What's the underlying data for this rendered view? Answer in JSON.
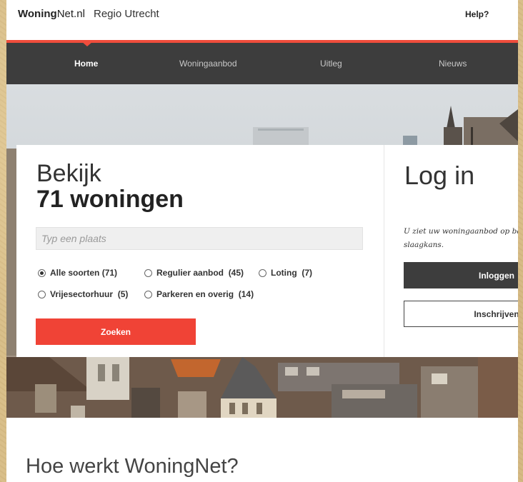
{
  "header": {
    "logo_bold": "Woning",
    "logo_rest": "Net.nl",
    "region": "Regio Utrecht",
    "help": "Help?"
  },
  "nav": {
    "items": [
      {
        "label": "Home",
        "active": true
      },
      {
        "label": "Woningaanbod",
        "active": false
      },
      {
        "label": "Uitleg",
        "active": false
      },
      {
        "label": "Nieuws",
        "active": false
      }
    ]
  },
  "search_card": {
    "title": "Bekijk",
    "count_label": "71 woningen",
    "placeholder": "Typ een plaats",
    "options": [
      {
        "label": "Alle soorten",
        "count": "(71)",
        "selected": true
      },
      {
        "label": "Regulier aanbod",
        "count": "(45)",
        "selected": false
      },
      {
        "label": "Loting",
        "count": "(7)",
        "selected": false
      },
      {
        "label": "Vrijesectorhuur",
        "count": "(5)",
        "selected": false
      },
      {
        "label": "Parkeren en overig",
        "count": "(14)",
        "selected": false
      }
    ],
    "submit": "Zoeken"
  },
  "login_card": {
    "title": "Log in",
    "text": "U ziet uw woningaanbod op basis van uw slaagkans.",
    "login_button": "Inloggen",
    "register_button": "Inschrijven"
  },
  "section": {
    "heading": "Hoe werkt WoningNet?"
  },
  "colors": {
    "accent": "#f04336",
    "nav_bg": "#3d3d3d"
  }
}
